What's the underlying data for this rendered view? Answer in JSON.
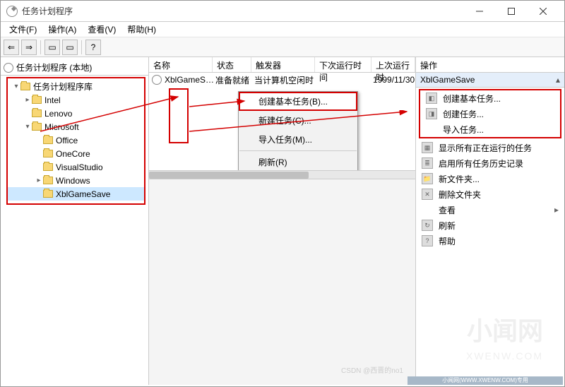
{
  "title": "任务计划程序",
  "menu": {
    "file": "文件(F)",
    "action": "操作(A)",
    "view": "查看(V)",
    "help": "帮助(H)"
  },
  "tree": {
    "root": "任务计划程序 (本地)",
    "lib": "任务计划程序库",
    "intel": "Intel",
    "lenovo": "Lenovo",
    "microsoft": "Microsoft",
    "office": "Office",
    "onecore": "OneCore",
    "visualstudio": "VisualStudio",
    "windows": "Windows",
    "xblgamesave": "XblGameSave"
  },
  "list": {
    "col_name": "名称",
    "col_status": "状态",
    "col_trigger": "触发器",
    "col_next": "下次运行时间",
    "col_last": "上次运行时",
    "row1_name": "XblGameSa...",
    "row1_status": "准备就绪",
    "row1_trigger": "当计算机空闲时",
    "row1_next": "",
    "row1_last": "1999/11/30"
  },
  "ctx": {
    "basic": "创建基本任务(B)...",
    "newtask": "新建任务(C)...",
    "import": "导入任务(M)...",
    "refresh": "刷新(R)"
  },
  "actions": {
    "header": "操作",
    "sub": "XblGameSave",
    "create_basic": "创建基本任务...",
    "create_task": "创建任务...",
    "import_task": "导入任务...",
    "show_running": "显示所有正在运行的任务",
    "enable_history": "启用所有任务历史记录",
    "new_folder": "新文件夹...",
    "delete_folder": "删除文件夹",
    "view": "查看",
    "refresh": "刷新",
    "help": "帮助"
  },
  "watermark": {
    "big": "小闻网",
    "url": "XWENW.COM",
    "bar": "小闻网(WWW.XWENW.COM)专用",
    "csdn": "CSDN @西晋的no1"
  }
}
